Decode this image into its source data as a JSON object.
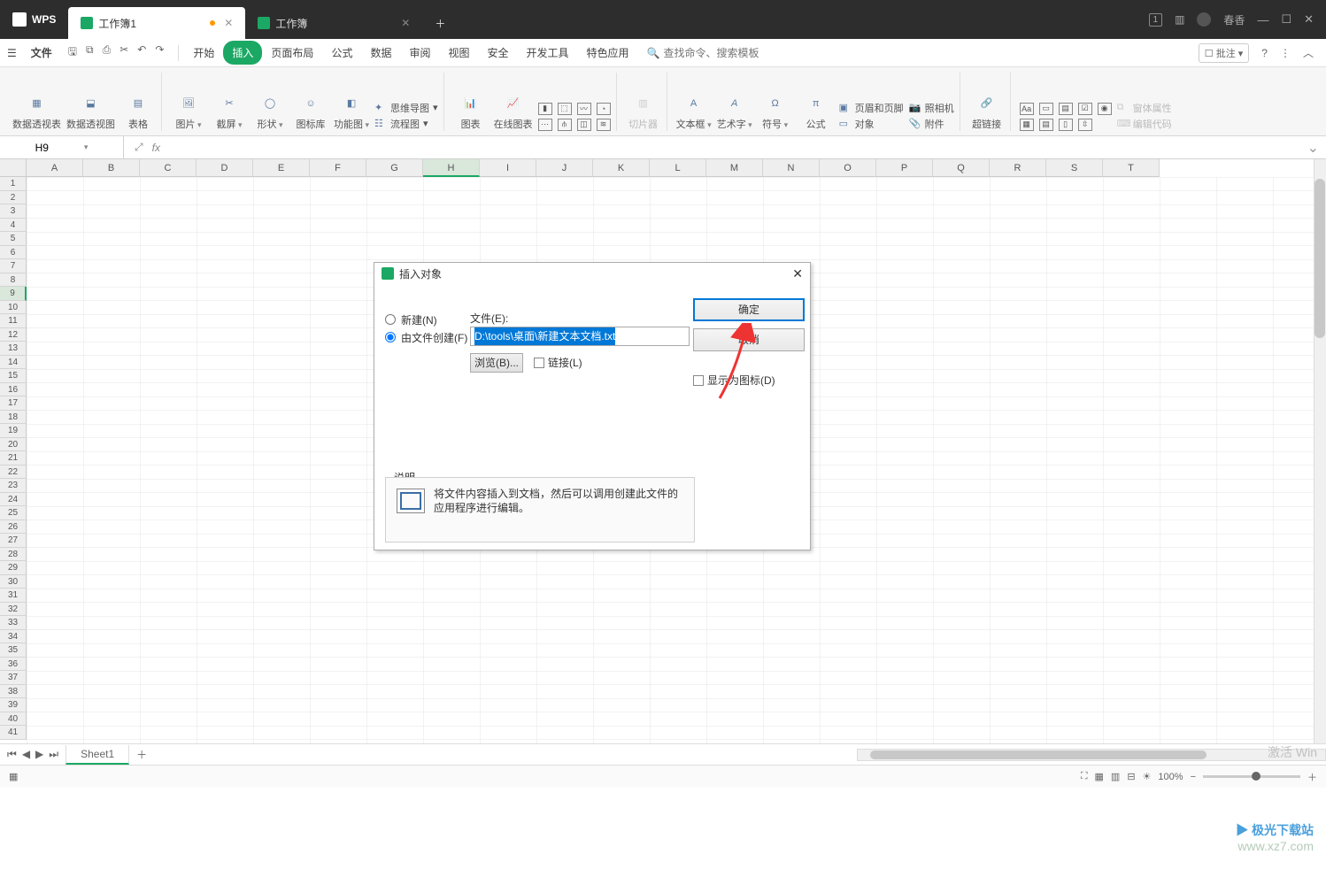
{
  "titlebar": {
    "app": "WPS",
    "tab_active": "工作簿1",
    "tab_other": "工作簿",
    "user": "春香",
    "badge": "1"
  },
  "menubar": {
    "file": "文件",
    "items": [
      "开始",
      "插入",
      "页面布局",
      "公式",
      "数据",
      "审阅",
      "视图",
      "安全",
      "开发工具",
      "特色应用"
    ],
    "active_index": 1,
    "search_placeholder": "查找命令、搜索模板",
    "pz": "批注"
  },
  "ribbon": {
    "pivot_table": "数据透视表",
    "pivot_chart": "数据透视图",
    "table": "表格",
    "picture": "图片",
    "screenshot": "截屏",
    "shapes": "形状",
    "icons": "图标库",
    "smartart": "功能图",
    "mindmap": "思维导图",
    "flowchart": "流程图",
    "chart": "图表",
    "online_chart": "在线图表",
    "slicer": "切片器",
    "textbox": "文本框",
    "wordart": "艺术字",
    "symbol": "符号",
    "equation": "公式",
    "header_footer": "页眉和页脚",
    "object": "对象",
    "camera": "照相机",
    "attachment": "附件",
    "hyperlink": "超链接",
    "form_props": "窗体属性",
    "edit_code": "编辑代码"
  },
  "namebox": "H9",
  "columns": [
    "A",
    "B",
    "C",
    "D",
    "E",
    "F",
    "G",
    "H",
    "I",
    "J",
    "K",
    "L",
    "M",
    "N",
    "O",
    "P",
    "Q",
    "R",
    "S",
    "T"
  ],
  "rows_count": 41,
  "selected_col": "H",
  "selected_row": 9,
  "sheet": "Sheet1",
  "dialog": {
    "title": "插入对象",
    "new": "新建(N)",
    "from_file": "由文件创建(F)",
    "file_label": "文件(E):",
    "file_value": "D:\\tools\\桌面\\新建文本文档.txt",
    "browse": "浏览(B)...",
    "link": "链接(L)",
    "ok": "确定",
    "cancel": "取消",
    "as_icon": "显示为图标(D)",
    "desc_label": "说明",
    "desc_text": "将文件内容插入到文档，然后可以调用创建此文件的应用程序进行编辑。"
  },
  "status": {
    "zoom": "100%"
  },
  "activate": "激活 Win",
  "watermark_site": "www.xz7.com",
  "watermark_name": "极光下载站"
}
